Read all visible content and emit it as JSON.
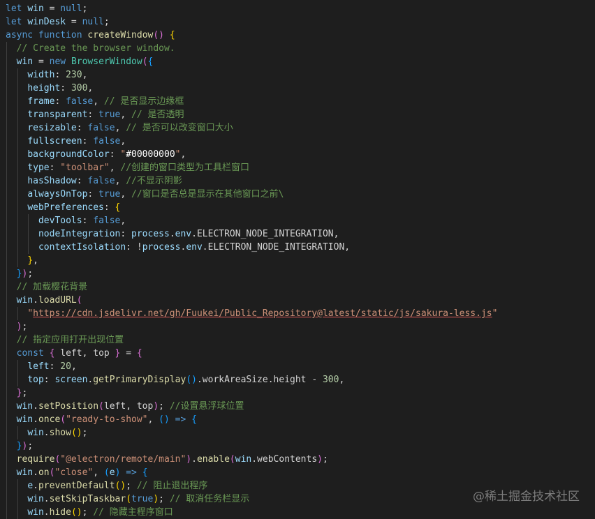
{
  "editor": {
    "theme": "dark",
    "background": "#1e1e1e",
    "lines": [
      {
        "indent": 0,
        "tokens": [
          {
            "c": "kwb",
            "t": "let"
          },
          {
            "c": "txt",
            "t": " "
          },
          {
            "c": "var",
            "t": "win"
          },
          {
            "c": "txt",
            "t": " = "
          },
          {
            "c": "kwb",
            "t": "null"
          },
          {
            "c": "txt",
            "t": ";"
          }
        ]
      },
      {
        "indent": 0,
        "tokens": [
          {
            "c": "kwb",
            "t": "let"
          },
          {
            "c": "txt",
            "t": " "
          },
          {
            "c": "var",
            "t": "winDesk"
          },
          {
            "c": "txt",
            "t": " = "
          },
          {
            "c": "kwb",
            "t": "null"
          },
          {
            "c": "txt",
            "t": ";"
          }
        ]
      },
      {
        "indent": 0,
        "tokens": [
          {
            "c": "kwb",
            "t": "async"
          },
          {
            "c": "txt",
            "t": " "
          },
          {
            "c": "kwb",
            "t": "function"
          },
          {
            "c": "txt",
            "t": " "
          },
          {
            "c": "fn",
            "t": "createWindow"
          },
          {
            "c": "brk2",
            "t": "()"
          },
          {
            "c": "txt",
            "t": " "
          },
          {
            "c": "brk1",
            "t": "{"
          }
        ]
      },
      {
        "indent": 1,
        "tokens": [
          {
            "c": "cmt",
            "t": "// Create the browser window."
          }
        ]
      },
      {
        "indent": 1,
        "tokens": [
          {
            "c": "var",
            "t": "win"
          },
          {
            "c": "txt",
            "t": " = "
          },
          {
            "c": "kwb",
            "t": "new"
          },
          {
            "c": "txt",
            "t": " "
          },
          {
            "c": "cls",
            "t": "BrowserWindow"
          },
          {
            "c": "brk2",
            "t": "("
          },
          {
            "c": "brk3",
            "t": "{"
          }
        ]
      },
      {
        "indent": 2,
        "tokens": [
          {
            "c": "var",
            "t": "width"
          },
          {
            "c": "txt",
            "t": ": "
          },
          {
            "c": "num",
            "t": "230"
          },
          {
            "c": "txt",
            "t": ","
          }
        ]
      },
      {
        "indent": 2,
        "tokens": [
          {
            "c": "var",
            "t": "height"
          },
          {
            "c": "txt",
            "t": ": "
          },
          {
            "c": "num",
            "t": "300"
          },
          {
            "c": "txt",
            "t": ","
          }
        ]
      },
      {
        "indent": 2,
        "tokens": [
          {
            "c": "var",
            "t": "frame"
          },
          {
            "c": "txt",
            "t": ": "
          },
          {
            "c": "kwb",
            "t": "false"
          },
          {
            "c": "txt",
            "t": ", "
          },
          {
            "c": "cmt",
            "t": "// 是否显示边缘框"
          }
        ]
      },
      {
        "indent": 2,
        "tokens": [
          {
            "c": "var",
            "t": "transparent"
          },
          {
            "c": "txt",
            "t": ": "
          },
          {
            "c": "kwb",
            "t": "true"
          },
          {
            "c": "txt",
            "t": ", "
          },
          {
            "c": "cmt",
            "t": "// 是否透明"
          }
        ]
      },
      {
        "indent": 2,
        "tokens": [
          {
            "c": "var",
            "t": "resizable"
          },
          {
            "c": "txt",
            "t": ": "
          },
          {
            "c": "kwb",
            "t": "false"
          },
          {
            "c": "txt",
            "t": ", "
          },
          {
            "c": "cmt",
            "t": "// 是否可以改变窗口大小"
          }
        ]
      },
      {
        "indent": 2,
        "tokens": [
          {
            "c": "var",
            "t": "fullscreen"
          },
          {
            "c": "txt",
            "t": ": "
          },
          {
            "c": "kwb",
            "t": "false"
          },
          {
            "c": "txt",
            "t": ","
          }
        ]
      },
      {
        "indent": 2,
        "tokens": [
          {
            "c": "var",
            "t": "backgroundColor"
          },
          {
            "c": "txt",
            "t": ": "
          },
          {
            "c": "str",
            "t": "\""
          },
          {
            "c": "strw",
            "t": "#00000000"
          },
          {
            "c": "str",
            "t": "\""
          },
          {
            "c": "txt",
            "t": ","
          }
        ]
      },
      {
        "indent": 2,
        "tokens": [
          {
            "c": "var",
            "t": "type"
          },
          {
            "c": "txt",
            "t": ": "
          },
          {
            "c": "str",
            "t": "\"toolbar\""
          },
          {
            "c": "txt",
            "t": ", "
          },
          {
            "c": "cmt",
            "t": "//创建的窗口类型为工具栏窗口"
          }
        ]
      },
      {
        "indent": 2,
        "tokens": [
          {
            "c": "var",
            "t": "hasShadow"
          },
          {
            "c": "txt",
            "t": ": "
          },
          {
            "c": "kwb",
            "t": "false"
          },
          {
            "c": "txt",
            "t": ", "
          },
          {
            "c": "cmt",
            "t": "//不显示阴影"
          }
        ]
      },
      {
        "indent": 2,
        "tokens": [
          {
            "c": "var",
            "t": "alwaysOnTop"
          },
          {
            "c": "txt",
            "t": ": "
          },
          {
            "c": "kwb",
            "t": "true"
          },
          {
            "c": "txt",
            "t": ", "
          },
          {
            "c": "cmt",
            "t": "//窗口是否总是显示在其他窗口之前\\"
          }
        ]
      },
      {
        "indent": 2,
        "tokens": [
          {
            "c": "var",
            "t": "webPreferences"
          },
          {
            "c": "txt",
            "t": ": "
          },
          {
            "c": "brk1",
            "t": "{"
          }
        ]
      },
      {
        "indent": 3,
        "tokens": [
          {
            "c": "var",
            "t": "devTools"
          },
          {
            "c": "txt",
            "t": ": "
          },
          {
            "c": "kwb",
            "t": "false"
          },
          {
            "c": "txt",
            "t": ","
          }
        ]
      },
      {
        "indent": 3,
        "tokens": [
          {
            "c": "var",
            "t": "nodeIntegration"
          },
          {
            "c": "txt",
            "t": ": "
          },
          {
            "c": "var",
            "t": "process"
          },
          {
            "c": "txt",
            "t": "."
          },
          {
            "c": "var",
            "t": "env"
          },
          {
            "c": "txt",
            "t": ".ELECTRON_NODE_INTEGRATION,"
          }
        ]
      },
      {
        "indent": 3,
        "tokens": [
          {
            "c": "var",
            "t": "contextIsolation"
          },
          {
            "c": "txt",
            "t": ": !"
          },
          {
            "c": "var",
            "t": "process"
          },
          {
            "c": "txt",
            "t": "."
          },
          {
            "c": "var",
            "t": "env"
          },
          {
            "c": "txt",
            "t": ".ELECTRON_NODE_INTEGRATION,"
          }
        ]
      },
      {
        "indent": 2,
        "tokens": [
          {
            "c": "brk1",
            "t": "}"
          },
          {
            "c": "txt",
            "t": ","
          }
        ]
      },
      {
        "indent": 1,
        "tokens": [
          {
            "c": "brk3",
            "t": "}"
          },
          {
            "c": "brk2",
            "t": ")"
          },
          {
            "c": "txt",
            "t": ";"
          }
        ]
      },
      {
        "indent": 1,
        "tokens": [
          {
            "c": "cmt",
            "t": "// 加载樱花背景"
          }
        ]
      },
      {
        "indent": 1,
        "tokens": [
          {
            "c": "var",
            "t": "win"
          },
          {
            "c": "txt",
            "t": "."
          },
          {
            "c": "fn",
            "t": "loadURL"
          },
          {
            "c": "brk2",
            "t": "("
          }
        ]
      },
      {
        "indent": 2,
        "tokens": [
          {
            "c": "str",
            "t": "\""
          },
          {
            "c": "url",
            "t": "https://cdn.jsdelivr.net/gh/Fuukei/Public_Repository@latest/static/js/sakura-less.js"
          },
          {
            "c": "str",
            "t": "\""
          }
        ]
      },
      {
        "indent": 1,
        "tokens": [
          {
            "c": "brk2",
            "t": ")"
          },
          {
            "c": "txt",
            "t": ";"
          }
        ]
      },
      {
        "indent": 1,
        "tokens": [
          {
            "c": "cmt",
            "t": "// 指定应用打开出现位置"
          }
        ]
      },
      {
        "indent": 1,
        "tokens": [
          {
            "c": "kwb",
            "t": "const"
          },
          {
            "c": "txt",
            "t": " "
          },
          {
            "c": "brk2",
            "t": "{"
          },
          {
            "c": "txt",
            "t": " left, top "
          },
          {
            "c": "brk2",
            "t": "}"
          },
          {
            "c": "txt",
            "t": " = "
          },
          {
            "c": "brk2",
            "t": "{"
          }
        ]
      },
      {
        "indent": 2,
        "tokens": [
          {
            "c": "var",
            "t": "left"
          },
          {
            "c": "txt",
            "t": ": "
          },
          {
            "c": "num",
            "t": "20"
          },
          {
            "c": "txt",
            "t": ","
          }
        ]
      },
      {
        "indent": 2,
        "tokens": [
          {
            "c": "var",
            "t": "top"
          },
          {
            "c": "txt",
            "t": ": "
          },
          {
            "c": "var",
            "t": "screen"
          },
          {
            "c": "txt",
            "t": "."
          },
          {
            "c": "fn",
            "t": "getPrimaryDisplay"
          },
          {
            "c": "brk3",
            "t": "()"
          },
          {
            "c": "txt",
            "t": ".workAreaSize.height - "
          },
          {
            "c": "num",
            "t": "300"
          },
          {
            "c": "txt",
            "t": ","
          }
        ]
      },
      {
        "indent": 1,
        "tokens": [
          {
            "c": "brk2",
            "t": "}"
          },
          {
            "c": "txt",
            "t": ";"
          }
        ]
      },
      {
        "indent": 1,
        "tokens": [
          {
            "c": "var",
            "t": "win"
          },
          {
            "c": "txt",
            "t": "."
          },
          {
            "c": "fn",
            "t": "setPosition"
          },
          {
            "c": "brk2",
            "t": "("
          },
          {
            "c": "txt",
            "t": "left, top"
          },
          {
            "c": "brk2",
            "t": ")"
          },
          {
            "c": "txt",
            "t": "; "
          },
          {
            "c": "cmt",
            "t": "//设置悬浮球位置"
          }
        ]
      },
      {
        "indent": 1,
        "tokens": [
          {
            "c": "var",
            "t": "win"
          },
          {
            "c": "txt",
            "t": "."
          },
          {
            "c": "fn",
            "t": "once"
          },
          {
            "c": "brk2",
            "t": "("
          },
          {
            "c": "str",
            "t": "\"ready-to-show\""
          },
          {
            "c": "txt",
            "t": ", "
          },
          {
            "c": "brk3",
            "t": "()"
          },
          {
            "c": "txt",
            "t": " "
          },
          {
            "c": "kwb",
            "t": "=>"
          },
          {
            "c": "txt",
            "t": " "
          },
          {
            "c": "brk3",
            "t": "{"
          }
        ]
      },
      {
        "indent": 2,
        "tokens": [
          {
            "c": "var",
            "t": "win"
          },
          {
            "c": "txt",
            "t": "."
          },
          {
            "c": "fn",
            "t": "show"
          },
          {
            "c": "brk1",
            "t": "()"
          },
          {
            "c": "txt",
            "t": ";"
          }
        ]
      },
      {
        "indent": 1,
        "tokens": [
          {
            "c": "brk3",
            "t": "}"
          },
          {
            "c": "brk2",
            "t": ")"
          },
          {
            "c": "txt",
            "t": ";"
          }
        ]
      },
      {
        "indent": 1,
        "tokens": [
          {
            "c": "fn",
            "t": "require"
          },
          {
            "c": "brk2",
            "t": "("
          },
          {
            "c": "str",
            "t": "\"@electron/remote/main\""
          },
          {
            "c": "brk2",
            "t": ")"
          },
          {
            "c": "txt",
            "t": "."
          },
          {
            "c": "fn",
            "t": "enable"
          },
          {
            "c": "brk2",
            "t": "("
          },
          {
            "c": "var",
            "t": "win"
          },
          {
            "c": "txt",
            "t": ".webContents"
          },
          {
            "c": "brk2",
            "t": ")"
          },
          {
            "c": "txt",
            "t": ";"
          }
        ]
      },
      {
        "indent": 1,
        "tokens": [
          {
            "c": "var",
            "t": "win"
          },
          {
            "c": "txt",
            "t": "."
          },
          {
            "c": "fn",
            "t": "on"
          },
          {
            "c": "brk2",
            "t": "("
          },
          {
            "c": "str",
            "t": "\"close\""
          },
          {
            "c": "txt",
            "t": ", "
          },
          {
            "c": "brk3",
            "t": "("
          },
          {
            "c": "var",
            "t": "e"
          },
          {
            "c": "brk3",
            "t": ")"
          },
          {
            "c": "txt",
            "t": " "
          },
          {
            "c": "kwb",
            "t": "=>"
          },
          {
            "c": "txt",
            "t": " "
          },
          {
            "c": "brk3",
            "t": "{"
          }
        ]
      },
      {
        "indent": 2,
        "tokens": [
          {
            "c": "var",
            "t": "e"
          },
          {
            "c": "txt",
            "t": "."
          },
          {
            "c": "fn",
            "t": "preventDefault"
          },
          {
            "c": "brk1",
            "t": "()"
          },
          {
            "c": "txt",
            "t": "; "
          },
          {
            "c": "cmt",
            "t": "// 阻止退出程序"
          }
        ]
      },
      {
        "indent": 2,
        "tokens": [
          {
            "c": "var",
            "t": "win"
          },
          {
            "c": "txt",
            "t": "."
          },
          {
            "c": "fn",
            "t": "setSkipTaskbar"
          },
          {
            "c": "brk1",
            "t": "("
          },
          {
            "c": "kwb",
            "t": "true"
          },
          {
            "c": "brk1",
            "t": ")"
          },
          {
            "c": "txt",
            "t": "; "
          },
          {
            "c": "cmt",
            "t": "// 取消任务栏显示"
          }
        ]
      },
      {
        "indent": 2,
        "tokens": [
          {
            "c": "var",
            "t": "win"
          },
          {
            "c": "txt",
            "t": "."
          },
          {
            "c": "fn",
            "t": "hide"
          },
          {
            "c": "brk1",
            "t": "()"
          },
          {
            "c": "txt",
            "t": "; "
          },
          {
            "c": "cmt",
            "t": "// 隐藏主程序窗口"
          }
        ]
      }
    ]
  },
  "watermark": {
    "text": "@稀土掘金技术社区"
  }
}
